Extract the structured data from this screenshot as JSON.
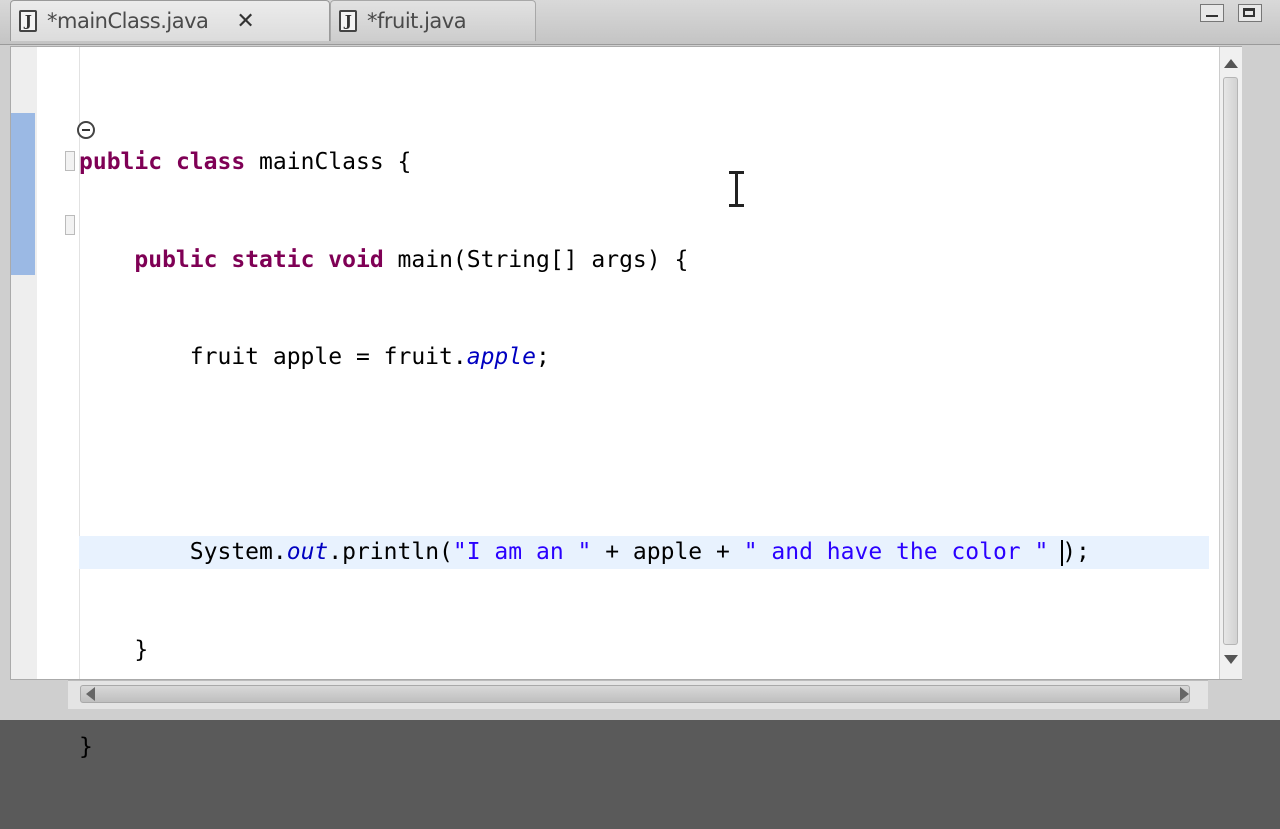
{
  "tabs": [
    {
      "label": "*mainClass.java",
      "active": true,
      "icon": "java-file-icon"
    },
    {
      "label": "*fruit.java",
      "active": false,
      "icon": "java-file-icon"
    }
  ],
  "tab_close_glyph": "✕",
  "icon_glyph": "J",
  "code": {
    "line1": {
      "kw1": "public",
      "kw2": "class",
      "text": " mainClass {"
    },
    "line2": {
      "kw1": "public",
      "kw2": "static",
      "kw3": "void",
      "text": " main(String[] args) {"
    },
    "line3": {
      "type": "fruit apple = fruit.",
      "field": "apple",
      "end": ";"
    },
    "line4": "",
    "line5": {
      "obj": "System.",
      "field": "out",
      "call": ".println(",
      "str1": "\"I am an \"",
      "mid1": " + apple + ",
      "str2": "\" and have the color \"",
      "space": " ",
      "end": ");"
    },
    "line6": "}",
    "line7": "}"
  },
  "colors": {
    "keyword": "#7f0055",
    "string": "#2a00ff",
    "field": "#0000c0",
    "current_line": "#e8f2fe",
    "change_bar": "#9bb9e4"
  }
}
